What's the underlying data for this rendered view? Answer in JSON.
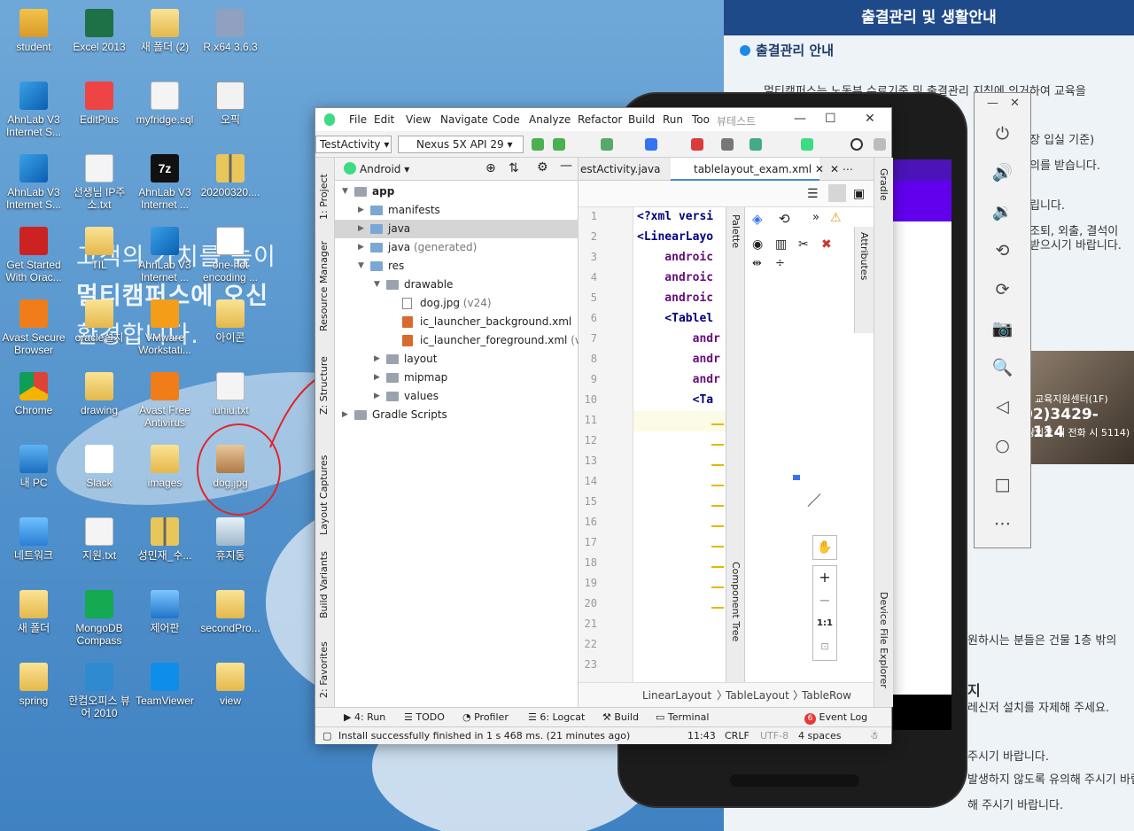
{
  "desktop": {
    "bg_text_line1": "고객의 가치를 높이",
    "bg_text_line2": "멀티캠퍼스에 오신",
    "bg_text_line3": "환경합니다.",
    "icons": [
      {
        "label": "student",
        "icon": "user-folder-icon"
      },
      {
        "label": "Excel 2013",
        "icon": "excel-icon"
      },
      {
        "label": "새 폴더 (2)",
        "icon": "folder-icon"
      },
      {
        "label": "R x64 3.6.3",
        "icon": "r-icon"
      },
      {
        "label": "AhnLab V3 Internet S...",
        "icon": "ahnlab-icon"
      },
      {
        "label": "EditPlus",
        "icon": "editplus-icon"
      },
      {
        "label": "myfridge.sql",
        "icon": "sql-file-icon"
      },
      {
        "label": "오픽",
        "icon": "file-icon"
      },
      {
        "label": "AhnLab V3 Internet S...",
        "icon": "ahnlab-icon"
      },
      {
        "label": "선생님 IP주소.txt",
        "icon": "text-file-icon"
      },
      {
        "label": "AhnLab V3 Internet ...",
        "icon": "7zip-icon"
      },
      {
        "label": "20200320....",
        "icon": "zip-icon"
      },
      {
        "label": "Get Started With Orac...",
        "icon": "oracle-icon"
      },
      {
        "label": "TIL",
        "icon": "folder-icon"
      },
      {
        "label": "AhnLab V3 Internet ...",
        "icon": "ahnlab-icon"
      },
      {
        "label": "one-hot encoding ...",
        "icon": "markdown-icon"
      },
      {
        "label": "Avast Secure Browser",
        "icon": "avast-browser-icon"
      },
      {
        "label": "oracle설치",
        "icon": "folder-icon"
      },
      {
        "label": "VMware Workstati...",
        "icon": "vmware-icon"
      },
      {
        "label": "아이콘",
        "icon": "folder-icon"
      },
      {
        "label": "Chrome",
        "icon": "chrome-icon"
      },
      {
        "label": "drawing",
        "icon": "folder-icon"
      },
      {
        "label": "Avast Free Antivirus",
        "icon": "avast-icon"
      },
      {
        "label": "iuhiu.txt",
        "icon": "text-file-icon"
      },
      {
        "label": "내 PC",
        "icon": "pc-icon"
      },
      {
        "label": "Slack",
        "icon": "slack-icon"
      },
      {
        "label": "images",
        "icon": "folder-icon"
      },
      {
        "label": "dog.jpg",
        "icon": "image-file-icon"
      },
      {
        "label": "네트워크",
        "icon": "network-icon"
      },
      {
        "label": "지원.txt",
        "icon": "text-file-icon"
      },
      {
        "label": "성민재_수...",
        "icon": "zip-icon"
      },
      {
        "label": "휴지통",
        "icon": "recycle-bin-icon"
      },
      {
        "label": "새 폴더",
        "icon": "folder-icon"
      },
      {
        "label": "MongoDB Compass",
        "icon": "mongodb-icon"
      },
      {
        "label": "제어판",
        "icon": "control-panel-icon"
      },
      {
        "label": "secondPro...",
        "icon": "folder-icon"
      },
      {
        "label": "spring",
        "icon": "folder-icon"
      },
      {
        "label": "한컴오피스 뷰어 2010",
        "icon": "hancom-icon"
      },
      {
        "label": "TeamViewer",
        "icon": "teamviewer-icon"
      },
      {
        "label": "view",
        "icon": "folder-icon"
      }
    ]
  },
  "right_panel": {
    "title": "출결관리 및 생활안내",
    "section": "출결관리 안내",
    "lines": [
      "멀티캠퍼스는 노동부 수료기준 및 출결관리 지침에 의거하여 교육을",
      "장 입실 기준)",
      "의를 받습니다.",
      "립니다.",
      "조퇴, 외출, 결석이",
      "받으시기 바랍니다.",
      "원하시는 분들은 건물 1층 밖의",
      "지",
      "레신저 설치를 자제해 주세요.",
      "주시기 바랍니다.",
      "발생하지 않도록 유의해 주시기 바랍니다.",
      "해 주시기 바랍니다."
    ],
    "photo_line1": "교육지원센터(1F)",
    "photo_line2": "02)3429-5114",
    "photo_line3": "강의장 내 전화 시 5114)"
  },
  "emulator_toolbar": {
    "buttons": [
      "power-icon",
      "volume-up-icon",
      "volume-down-icon",
      "rotate-left-icon",
      "rotate-right-icon",
      "camera-icon",
      "zoom-icon",
      "back-icon",
      "home-icon",
      "overview-icon",
      "more-icon"
    ],
    "glyphs": [
      "⏻",
      "🔊",
      "🔉",
      "⟲",
      "⟳",
      "📷",
      "🔍",
      "◁",
      "○",
      "□",
      "⋯"
    ]
  },
  "ide": {
    "menu": [
      "File",
      "Edit",
      "View",
      "Navigate",
      "Code",
      "Analyze",
      "Refactor",
      "Build",
      "Run",
      "Too",
      "뷰테스트"
    ],
    "run_config": "TestActivity",
    "device": "Nexus 5X API 29",
    "project_view": "Android",
    "left_tabs": [
      "1: Project",
      "Resource Manager",
      "Z: Structure",
      "Layout Captures",
      "Build Variants",
      "2: Favorites"
    ],
    "right_tabs": [
      "Gradle",
      "Device File Explorer"
    ],
    "tree": [
      {
        "label": "app",
        "level": 0,
        "expanded": true,
        "type": "app"
      },
      {
        "label": "manifests",
        "level": 1,
        "expanded": false,
        "type": "folder"
      },
      {
        "label": "java",
        "level": 1,
        "expanded": false,
        "type": "folder",
        "selected": true
      },
      {
        "label": "java",
        "suffix": "(generated)",
        "level": 1,
        "expanded": false,
        "type": "folder"
      },
      {
        "label": "res",
        "level": 1,
        "expanded": true,
        "type": "folder"
      },
      {
        "label": "drawable",
        "level": 2,
        "expanded": true,
        "type": "folder"
      },
      {
        "label": "dog.jpg",
        "suffix": "(v24)",
        "level": 3,
        "type": "file"
      },
      {
        "label": "ic_launcher_background.xml",
        "level": 3,
        "type": "xml"
      },
      {
        "label": "ic_launcher_foreground.xml",
        "suffix": "(v24)",
        "level": 3,
        "type": "xml"
      },
      {
        "label": "layout",
        "level": 2,
        "expanded": false,
        "type": "folder"
      },
      {
        "label": "mipmap",
        "level": 2,
        "expanded": false,
        "type": "folder"
      },
      {
        "label": "values",
        "level": 2,
        "expanded": false,
        "type": "folder"
      },
      {
        "label": "Gradle Scripts",
        "level": 0,
        "expanded": false,
        "type": "gradle"
      }
    ],
    "editor_tabs": [
      "estActivity.java",
      "tablelayout_exam.xml"
    ],
    "line_numbers": [
      "1",
      "2",
      "3",
      "4",
      "5",
      "6",
      "7",
      "8",
      "9",
      "10",
      "11",
      "12",
      "13",
      "14",
      "15",
      "16",
      "17",
      "18",
      "19",
      "20",
      "21",
      "22",
      "23"
    ],
    "code_lines": [
      "<?xml versi",
      "<LinearLayo",
      "    androic",
      "    androic",
      "    androic",
      "    <Tablel",
      "        andr",
      "        andr",
      "        andr",
      "        <Ta"
    ],
    "palette_label": "Palette",
    "component_tree_label": "Component Tree",
    "attributes_label": "Attributes",
    "zoom_ratio": "1:1",
    "breadcrumb": [
      "LinearLayout",
      "TableLayout",
      "TableRow"
    ],
    "bottom_tabs": [
      "4: Run",
      "TODO",
      "Profiler",
      "6: Logcat",
      "Build",
      "Terminal"
    ],
    "event_log": "Event Log",
    "event_count": "6",
    "status_message": "Install successfully finished in 1 s 468 ms. (21 minutes ago)",
    "cursor_pos": "11:43",
    "line_sep": "CRLF",
    "encoding": "UTF-8",
    "indent": "4 spaces"
  },
  "colors": {
    "annotation_red": "#e0252b",
    "android_purple": "#6200ee",
    "panel_header": "#1f4a8a"
  }
}
